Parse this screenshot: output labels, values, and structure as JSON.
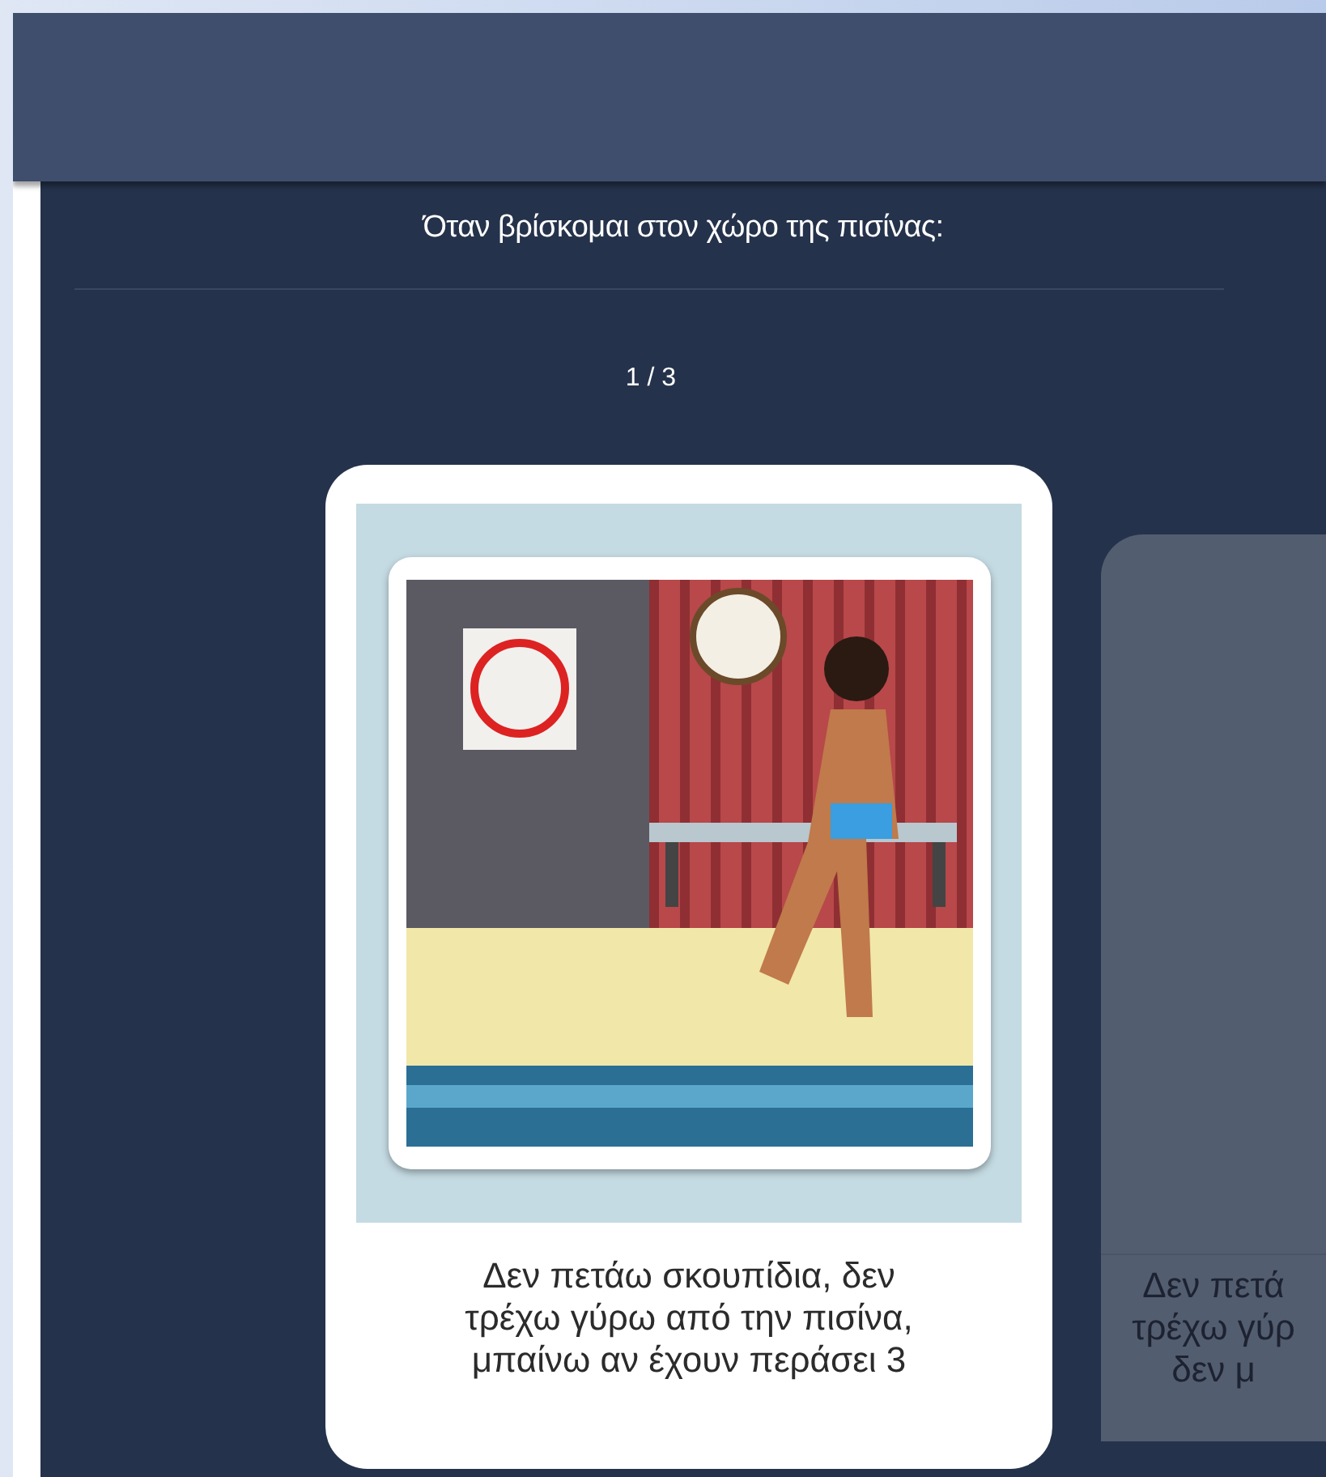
{
  "prompt": "Όταν βρίσκομαι στον χώρο της πισίνας:",
  "counter": "1 / 3",
  "cards": [
    {
      "active": true,
      "lines": [
        "Δεν πετάω σκουπίδια, δεν",
        "τρέχω γύρω από την πισίνα,",
        "μπαίνω αν έχουν περάσει 3"
      ]
    },
    {
      "active": false,
      "lines": [
        "Δεν πετά",
        "τρέχω γύρ",
        "δεν μ"
      ]
    }
  ]
}
